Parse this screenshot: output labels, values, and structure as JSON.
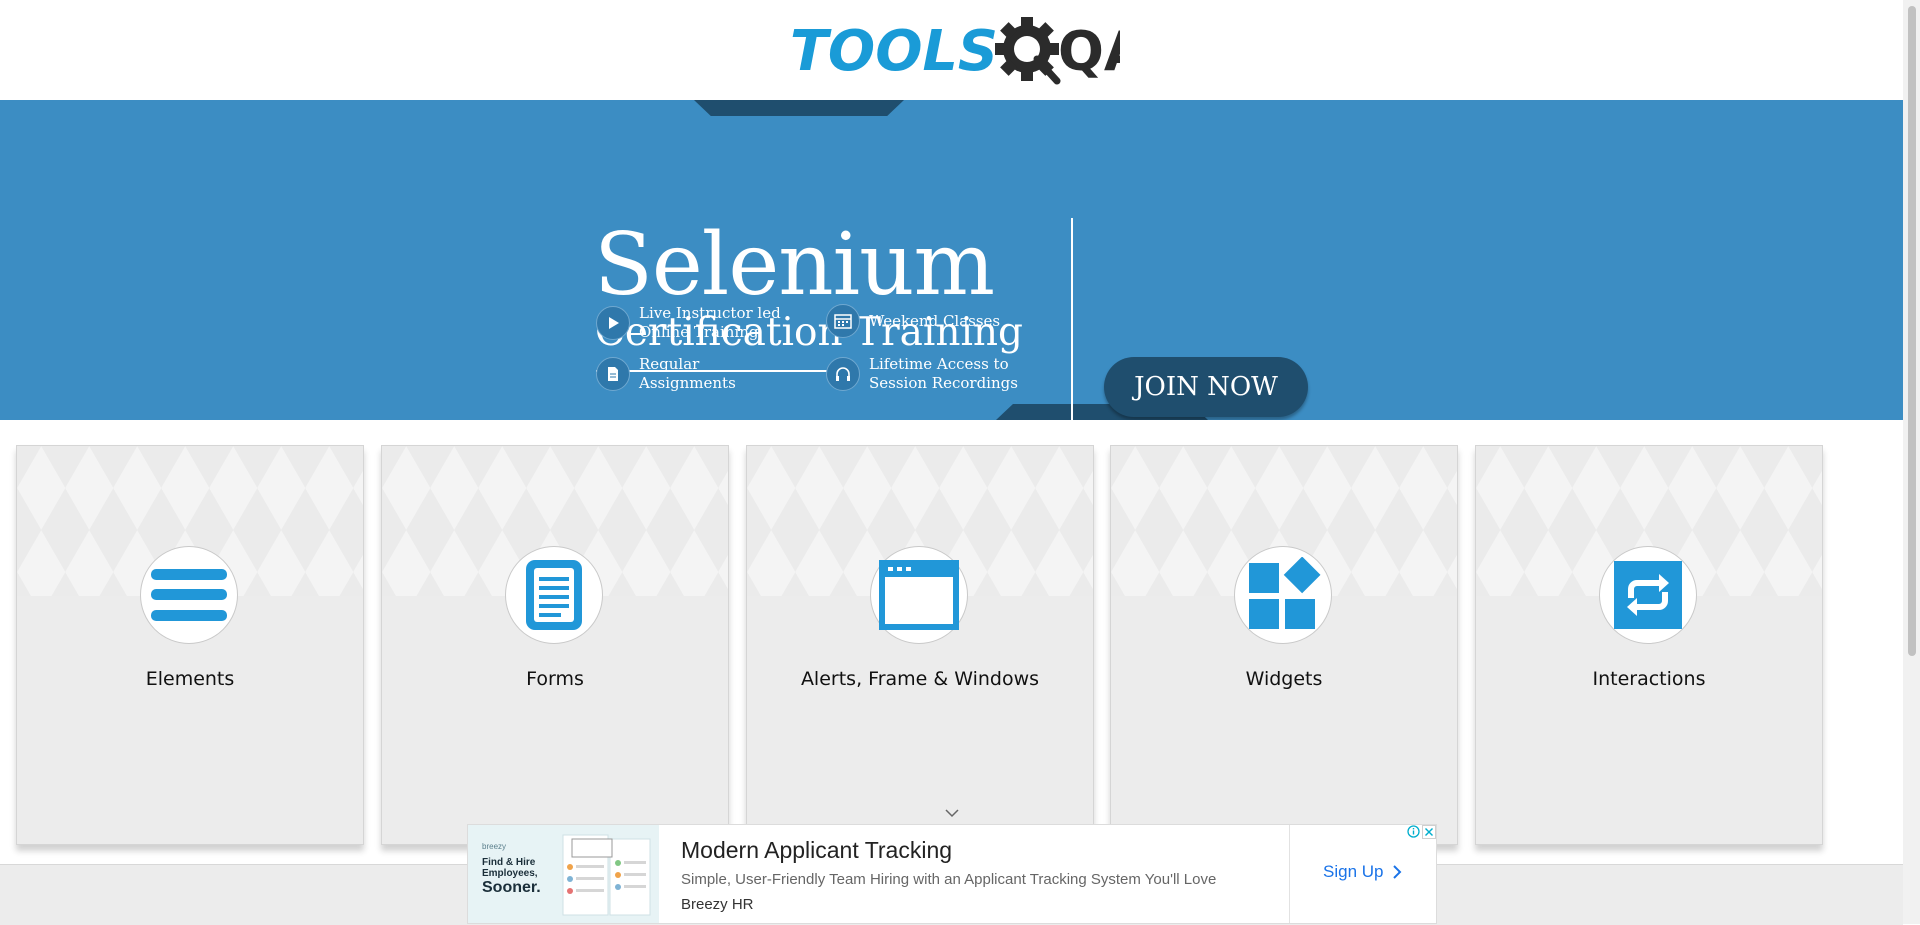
{
  "logo": {
    "text_primary": "TOOLS",
    "text_secondary": "QA",
    "colors": {
      "primary": "#1a9bd7",
      "secondary": "#2b2b2b"
    }
  },
  "banner": {
    "title": "Selenium",
    "subtitle": "Certification Training",
    "features": [
      {
        "icon": "play-icon",
        "line1": "Live Instructor led",
        "line2": "Online Training"
      },
      {
        "icon": "calendar-icon",
        "line1": "Weekend Classes",
        "line2": ""
      },
      {
        "icon": "document-icon",
        "line1": "Regular",
        "line2": "Assignments"
      },
      {
        "icon": "headphones-icon",
        "line1": "Lifetime Access to",
        "line2": "Session Recordings"
      }
    ],
    "cta_label": "JOIN NOW",
    "colors": {
      "background": "#3c8dc3",
      "dark": "#1f4e6e"
    }
  },
  "cards": [
    {
      "label": "Elements",
      "icon": "hamburger-list-icon"
    },
    {
      "label": "Forms",
      "icon": "form-document-icon"
    },
    {
      "label": "Alerts, Frame & Windows",
      "icon": "browser-window-icon"
    },
    {
      "label": "Widgets",
      "icon": "widgets-grid-icon"
    },
    {
      "label": "Interactions",
      "icon": "repeat-arrows-icon"
    }
  ],
  "accent_color": "#2197d8",
  "ad": {
    "title": "Modern Applicant Tracking",
    "description": "Simple, User-Friendly Team Hiring with an Applicant Tracking System You'll Love",
    "brand": "Breezy HR",
    "cta": "Sign Up",
    "image": {
      "brand": "breezy",
      "headline_1": "Find & Hire",
      "headline_2": "Employees,",
      "headline_3": "Sooner."
    }
  }
}
